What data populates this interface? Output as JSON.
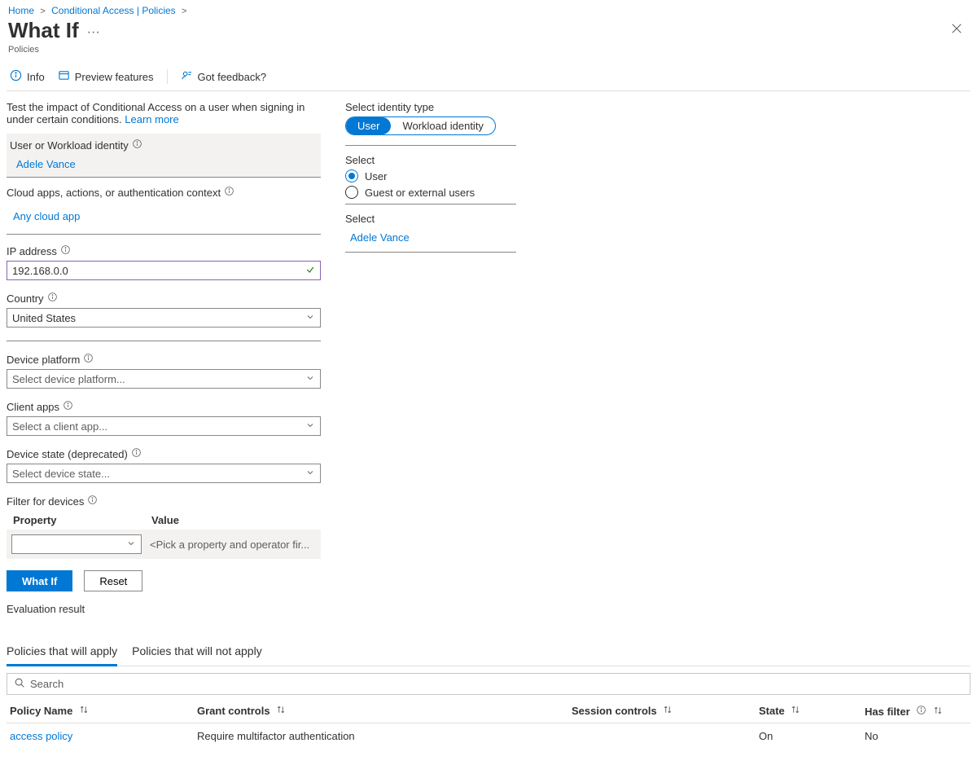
{
  "breadcrumb": {
    "home": "Home",
    "ca": "Conditional Access | Policies"
  },
  "title": "What If",
  "subtitle": "Policies",
  "commands": {
    "info": "Info",
    "preview": "Preview features",
    "feedback": "Got feedback?"
  },
  "description": "Test the impact of Conditional Access on a user when signing in under certain conditions. ",
  "learn_more": "Learn more",
  "left": {
    "identity_section": "User or Workload identity",
    "identity_value": "Adele Vance",
    "apps_section": "Cloud apps, actions, or authentication context",
    "apps_value": "Any cloud app",
    "ip_label": "IP address",
    "ip_value": "192.168.0.0",
    "country_label": "Country",
    "country_value": "United States",
    "device_platform_label": "Device platform",
    "device_platform_placeholder": "Select device platform...",
    "client_apps_label": "Client apps",
    "client_apps_placeholder": "Select a client app...",
    "device_state_label": "Device state (deprecated)",
    "device_state_placeholder": "Select device state...",
    "filter_label": "Filter for devices",
    "filter_col1": "Property",
    "filter_col2": "Value",
    "filter_val_placeholder": "<Pick a property and operator fir...",
    "what_if_btn": "What If",
    "reset_btn": "Reset"
  },
  "right": {
    "identity_type_label": "Select identity type",
    "pill_user": "User",
    "pill_workload": "Workload identity",
    "select_label": "Select",
    "radio_user": "User",
    "radio_guest": "Guest or external users",
    "select2_label": "Select",
    "selected_user_link": "Adele Vance"
  },
  "results": {
    "heading": "Evaluation result",
    "tab_apply": "Policies that will apply",
    "tab_not_apply": "Policies that will not apply",
    "search_placeholder": "Search",
    "cols": {
      "name": "Policy Name",
      "grant": "Grant controls",
      "session": "Session controls",
      "state": "State",
      "filter": "Has filter"
    },
    "rows": [
      {
        "name": "access policy",
        "grant": "Require multifactor authentication",
        "session": "",
        "state": "On",
        "filter": "No"
      }
    ]
  }
}
